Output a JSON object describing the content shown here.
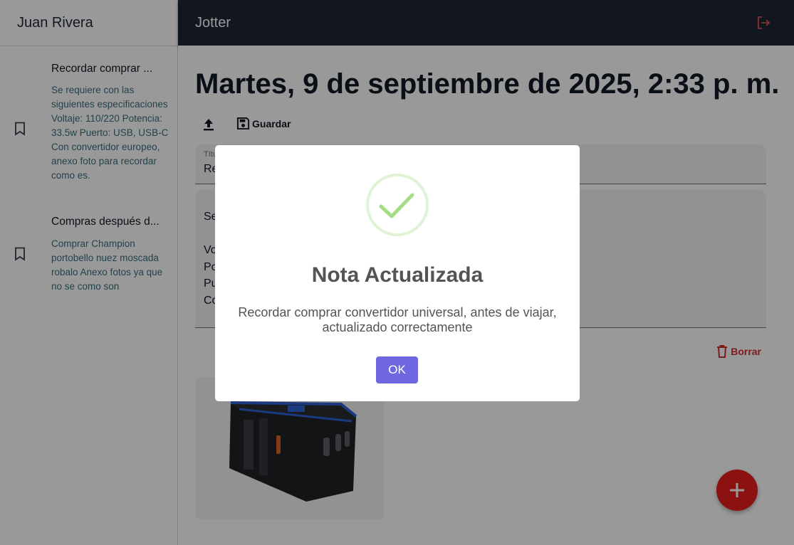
{
  "sidebar": {
    "user_name": "Juan Rivera",
    "notes": [
      {
        "title": "Recordar comprar ...",
        "preview": "Se requiere con las siguientes especificaciones Voltaje: 110/220 Potencia: 33.5w Puerto: USB, USB-C Con convertidor europeo, anexo foto para recordar como es.",
        "icon": "bookmark-icon"
      },
      {
        "title": "Compras después d...",
        "preview": "Comprar Champion portobello nuez moscada robalo Anexo fotos ya que no se como son",
        "icon": "bookmark-icon"
      }
    ]
  },
  "topbar": {
    "app_title": "Jotter",
    "logout_icon": "logout-icon"
  },
  "editor": {
    "date_title": "Martes, 9 de septiembre de 2025, 2:33 p. m.",
    "save_label": "Guardar",
    "title_label": "Títu",
    "title_value": "Re",
    "body_lines": "Se\n\nVo\nPo\nPu\nCo",
    "delete_label": "Borrar"
  },
  "modal": {
    "title": "Nota Actualizada",
    "message": "Recordar comprar convertidor universal, antes de viajar, actualizado correctamente",
    "ok_label": "OK",
    "icon": "success-check-icon"
  },
  "colors": {
    "topbar_bg": "#1d2535",
    "fab": "#ea1d1d",
    "delete": "#d32f2f",
    "ok_button": "#7066e0",
    "success": "#a5dc86"
  }
}
